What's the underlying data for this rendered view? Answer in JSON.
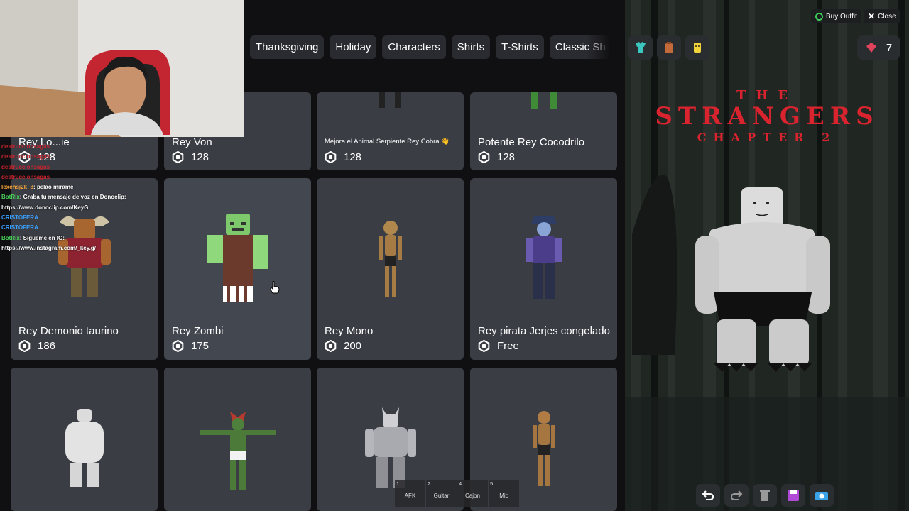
{
  "catalog": {
    "tabs": [
      "Thanksgiving",
      "Holiday",
      "Characters",
      "Shirts",
      "T-Shirts",
      "Classic Sh"
    ],
    "row1": [
      {
        "name": "Rey Lo...ie",
        "price": "128"
      },
      {
        "name": "Rey Von",
        "price": "128"
      },
      {
        "name": "Mejora el Animal Serpiente Rey Cobra 👋",
        "price": "128"
      },
      {
        "name": "Potente Rey Cocodrilo",
        "price": "128"
      }
    ],
    "row2": [
      {
        "name": "Rey Demonio taurino",
        "price": "186"
      },
      {
        "name": "Rey Zombi",
        "price": "175"
      },
      {
        "name": "Rey Mono",
        "price": "200"
      },
      {
        "name": "Rey pirata Jerjes congelado",
        "price": "Free"
      }
    ]
  },
  "chat": [
    {
      "user": "lexchsj2k_8",
      "text": ": pelao mirame"
    },
    {
      "user": "BotRix",
      "text": ": Graba tu mensaje de voz en Donoclip:"
    },
    {
      "user": "",
      "text": "https://www.donoclip.com/KeyG"
    },
    {
      "user": "BotRix",
      "text": ": Sigueme en IG:"
    },
    {
      "user": "",
      "text": "https://www.instagram.com/_key.g/"
    }
  ],
  "hotbar": [
    {
      "num": "1",
      "label": "AFK"
    },
    {
      "num": "2",
      "label": "Guitar"
    },
    {
      "num": "4",
      "label": "Cajon"
    },
    {
      "num": "5",
      "label": "Mic"
    }
  ],
  "preview": {
    "buy_outfit": "Buy Outfit",
    "close": "Close",
    "counter": "7",
    "banner_the": "THE",
    "banner_title": "STRANGERS",
    "banner_sub": "CHAPTER 2"
  }
}
